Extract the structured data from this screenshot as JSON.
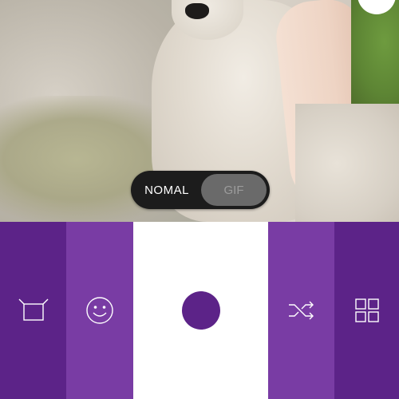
{
  "camera_mode": {
    "normal_label": "NOMAL",
    "gif_label": "GIF",
    "selected": "NOMAL"
  },
  "toolbar": {
    "items": [
      {
        "icon": "crop-frame-icon"
      },
      {
        "icon": "smiley-icon"
      },
      {
        "icon": "shutter-button"
      },
      {
        "icon": "shuffle-icon"
      },
      {
        "icon": "grid-icon"
      }
    ]
  },
  "colors": {
    "dark_purple": "#5c2388",
    "medium_purple": "#793ca4",
    "toggle_background": "#1c1c1c",
    "toggle_active_thumb": "#6a6a6a"
  }
}
